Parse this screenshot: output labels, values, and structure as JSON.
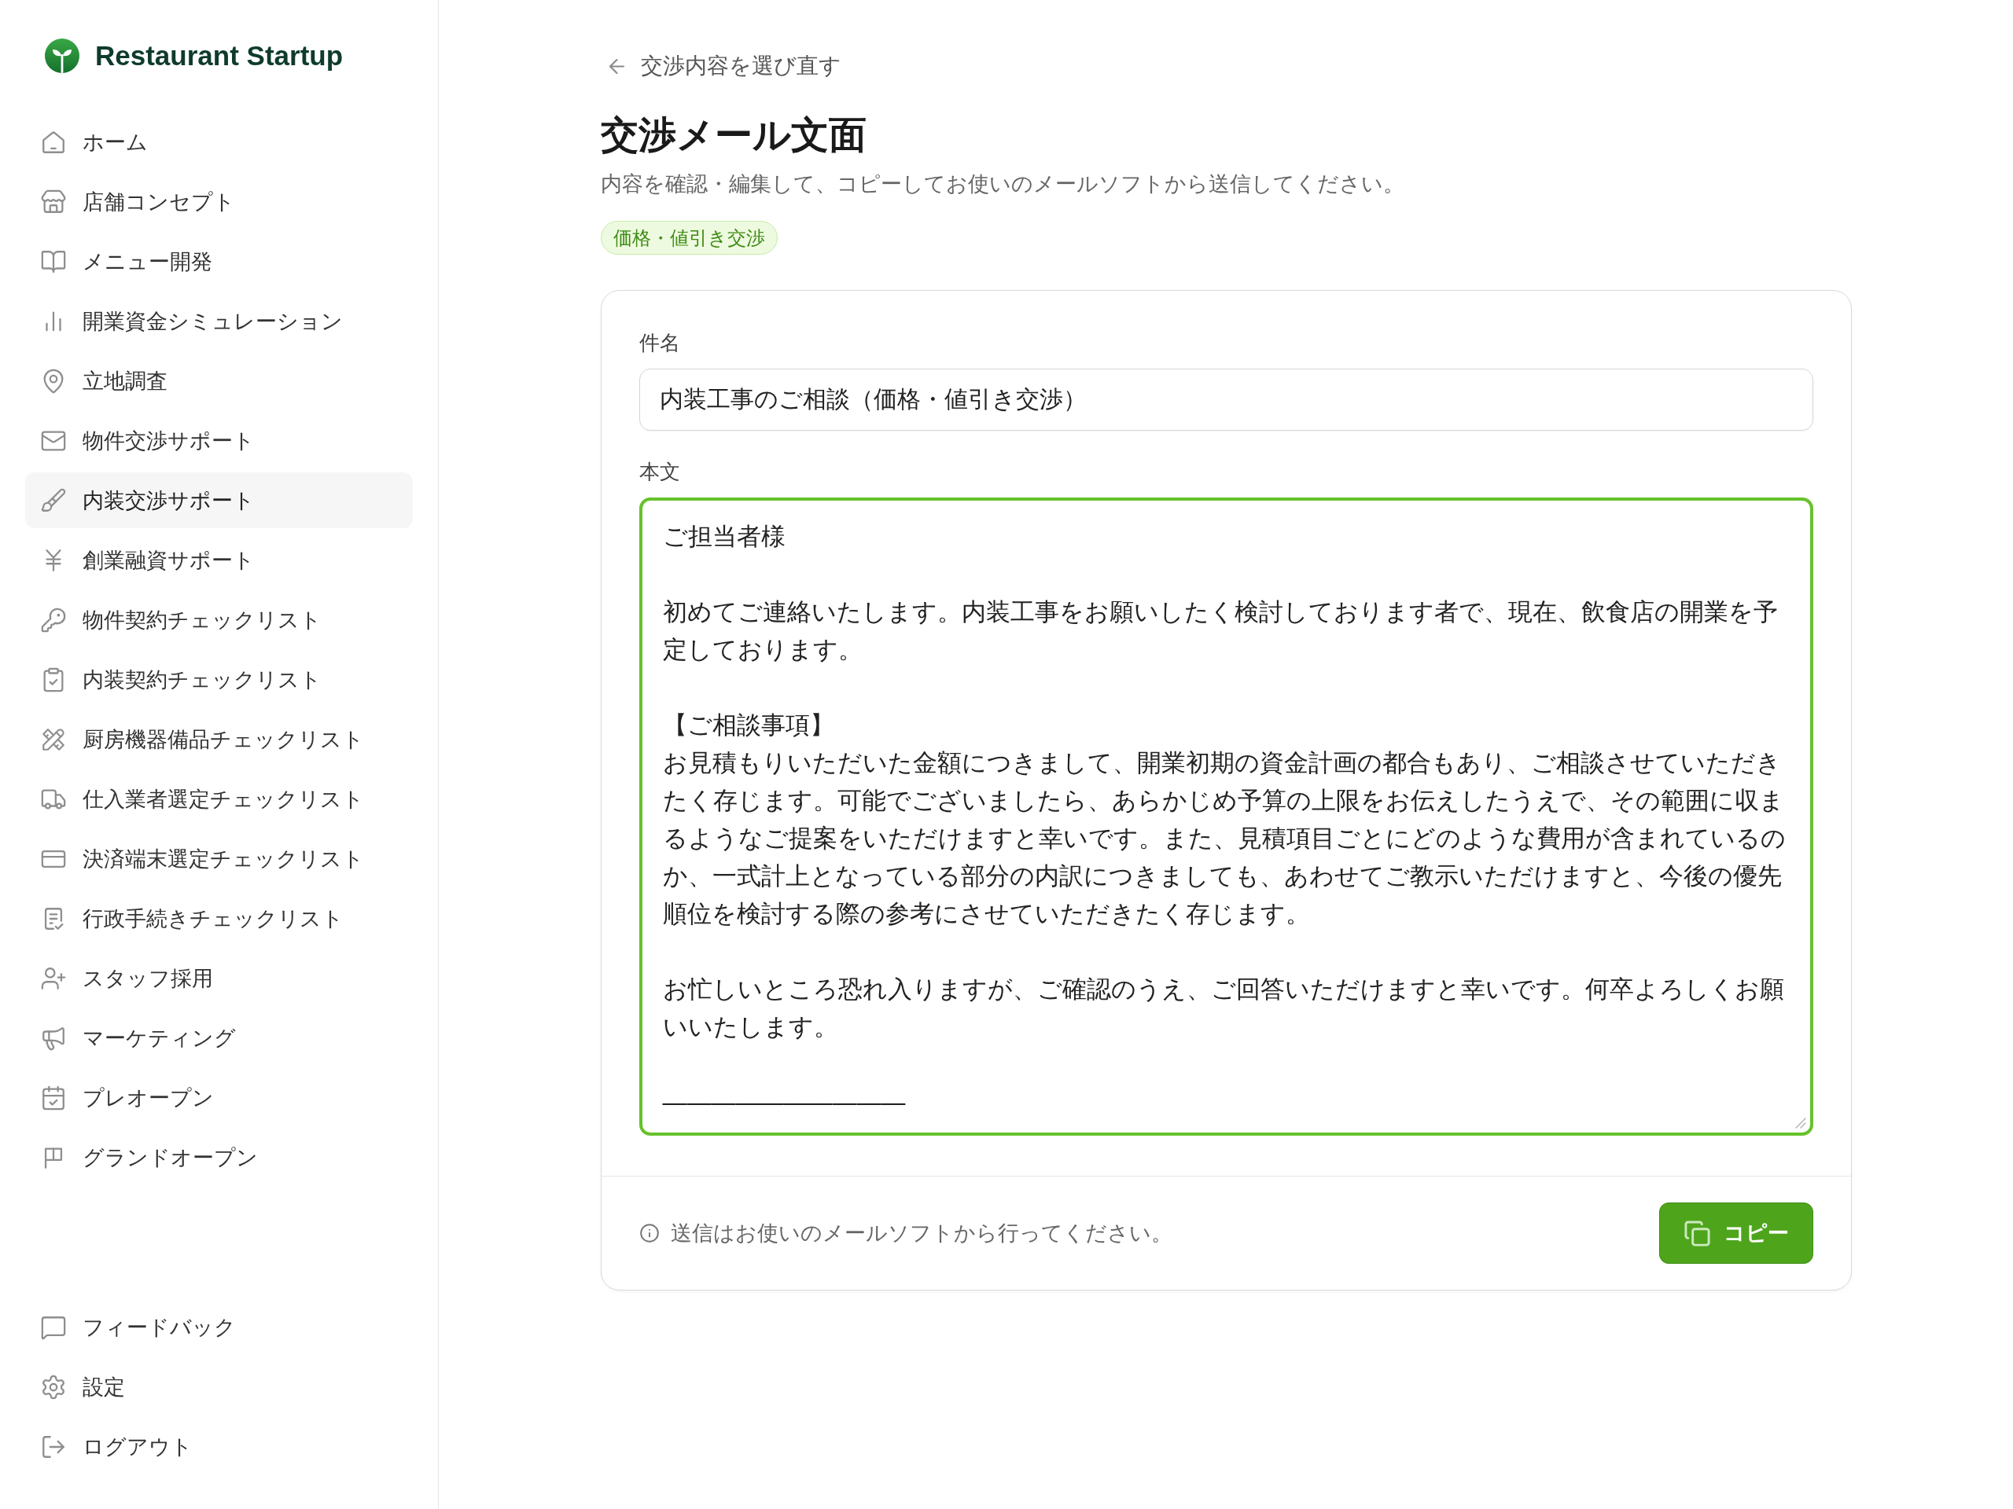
{
  "sidebar": {
    "brand": "Restaurant Startup",
    "nav_items": [
      {
        "label": "ホーム",
        "selected": false
      },
      {
        "label": "店舗コンセプト",
        "selected": false
      },
      {
        "label": "メニュー開発",
        "selected": false
      },
      {
        "label": "開業資金シミュレーション",
        "selected": false
      },
      {
        "label": "立地調査",
        "selected": false
      },
      {
        "label": "物件交渉サポート",
        "selected": false
      },
      {
        "label": "内装交渉サポート",
        "selected": true
      },
      {
        "label": "創業融資サポート",
        "selected": false
      },
      {
        "label": "物件契約チェックリスト",
        "selected": false
      },
      {
        "label": "内装契約チェックリスト",
        "selected": false
      },
      {
        "label": "厨房機器備品チェックリスト",
        "selected": false
      },
      {
        "label": "仕入業者選定チェックリスト",
        "selected": false
      },
      {
        "label": "決済端末選定チェックリスト",
        "selected": false
      },
      {
        "label": "行政手続きチェックリスト",
        "selected": false
      },
      {
        "label": "スタッフ採用",
        "selected": false
      },
      {
        "label": "マーケティング",
        "selected": false
      },
      {
        "label": "プレオープン",
        "selected": false
      },
      {
        "label": "グランドオープン",
        "selected": false
      }
    ],
    "footer_items": [
      {
        "label": "フィードバック"
      },
      {
        "label": "設定"
      },
      {
        "label": "ログアウト"
      }
    ]
  },
  "main": {
    "back_link": "交渉内容を選び直す",
    "title": "交渉メール文面",
    "subtitle": "内容を確認・編集して、コピーしてお使いのメールソフトから送信してください。",
    "tag": "価格・値引き交渉",
    "form": {
      "subject": {
        "label": "件名",
        "value": "内装工事のご相談（価格・値引き交渉）"
      },
      "body": {
        "label": "本文",
        "focused": true,
        "paragraphs": [
          [
            "ご担当者様"
          ],
          [
            "初めてご連絡いたします。内装工事をお願いしたく検討しております者で、現在、飲食店の開業を予定しております。"
          ],
          [
            "【ご相談事項】",
            "お見積もりいただいた金額につきまして、開業初期の資金計画の都合もあり、ご相談させていただきたく存じます。可能でございましたら、あらかじめ予算の上限をお伝えしたうえで、その範囲に収まるようなご提案をいただけますと幸いです。また、見積項目ごとにどのような費用が含まれているのか、一式計上となっている部分の内訳につきましても、あわせてご教示いただけますと、今後の優先順位を検討する際の参考にさせていただきたく存じます。"
          ],
          [
            "お忙しいところ恐れ入りますが、ご確認のうえ、ご回答いただけますと幸いです。何卒よろしくお願いいたします。"
          ],
          [
            "——————————"
          ]
        ]
      },
      "note": "送信はお使いのメールソフトから行ってください。",
      "copy_button": "コピー"
    }
  }
}
